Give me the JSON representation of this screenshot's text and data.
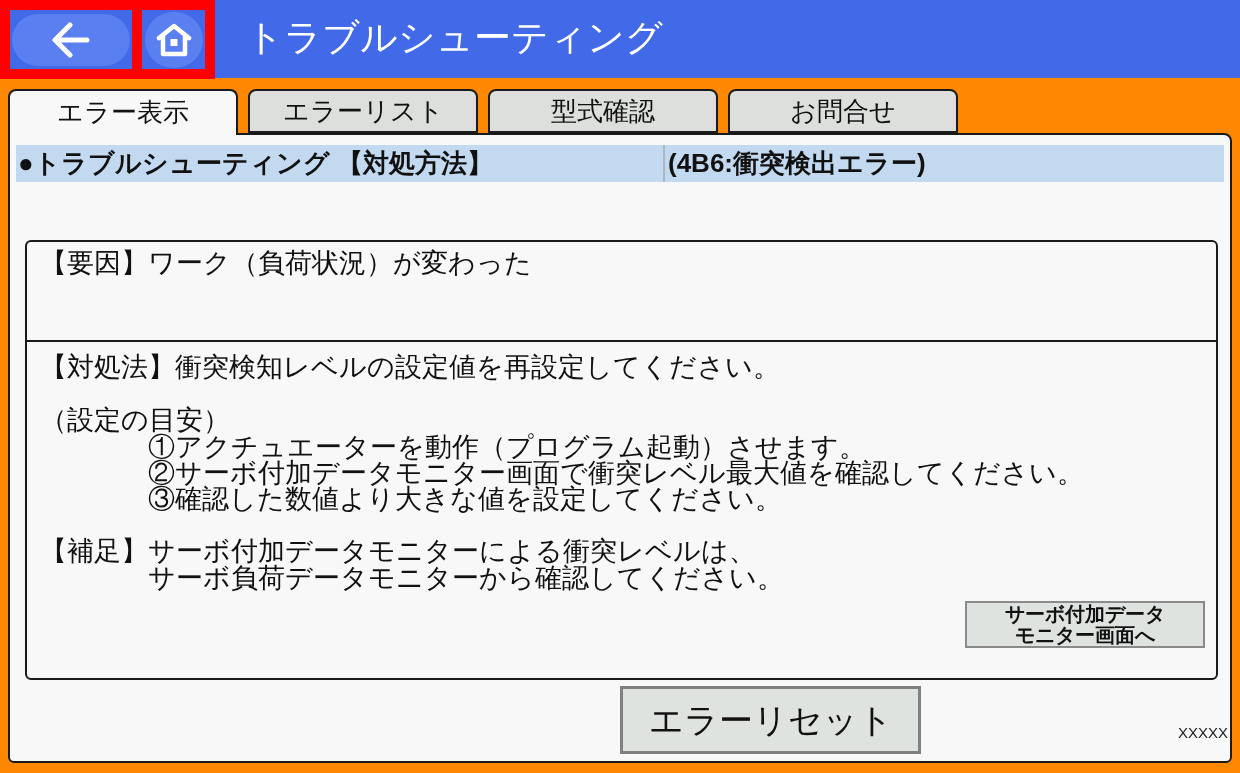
{
  "header": {
    "nav_buttons": [
      {
        "kind": "back",
        "highlighted": true
      },
      {
        "kind": "home",
        "highlighted": true
      }
    ],
    "title": "トラブルシューティング"
  },
  "tabs": [
    {
      "label": "エラー表示",
      "selected": true
    },
    {
      "label": "エラーリスト",
      "selected": false
    },
    {
      "label": "型式確認",
      "selected": false
    },
    {
      "label": "お問合せ",
      "selected": false
    }
  ],
  "section_bar": {
    "title": "●トラブルシューティング 【対処方法】",
    "error": "(4B6:衝突検出エラー)"
  },
  "cause": "【要因】ワーク（負荷状況）が変わった",
  "remedy": {
    "method": "【対処法】衝突検知レベルの設定値を再設定してください。",
    "guide_title": "（設定の目安）",
    "guide_steps": [
      "①アクチュエーターを動作（プログラム起動）させます。",
      "②サーボ付加データモニター画面で衝突レベル最大値を確認してください。",
      "③確認した数値より大きな値を設定してください。"
    ],
    "note": {
      "label": "【補足】",
      "lines": [
        "サーボ付加データモニターによる衝突レベルは、",
        "サーボ負荷データモニターから確認してください。"
      ]
    }
  },
  "monitor_button": {
    "lines": [
      "サーボ付加データ",
      "モニター画面へ"
    ]
  },
  "reset_button": "エラーリセット",
  "footer_code": "XXXXX"
}
